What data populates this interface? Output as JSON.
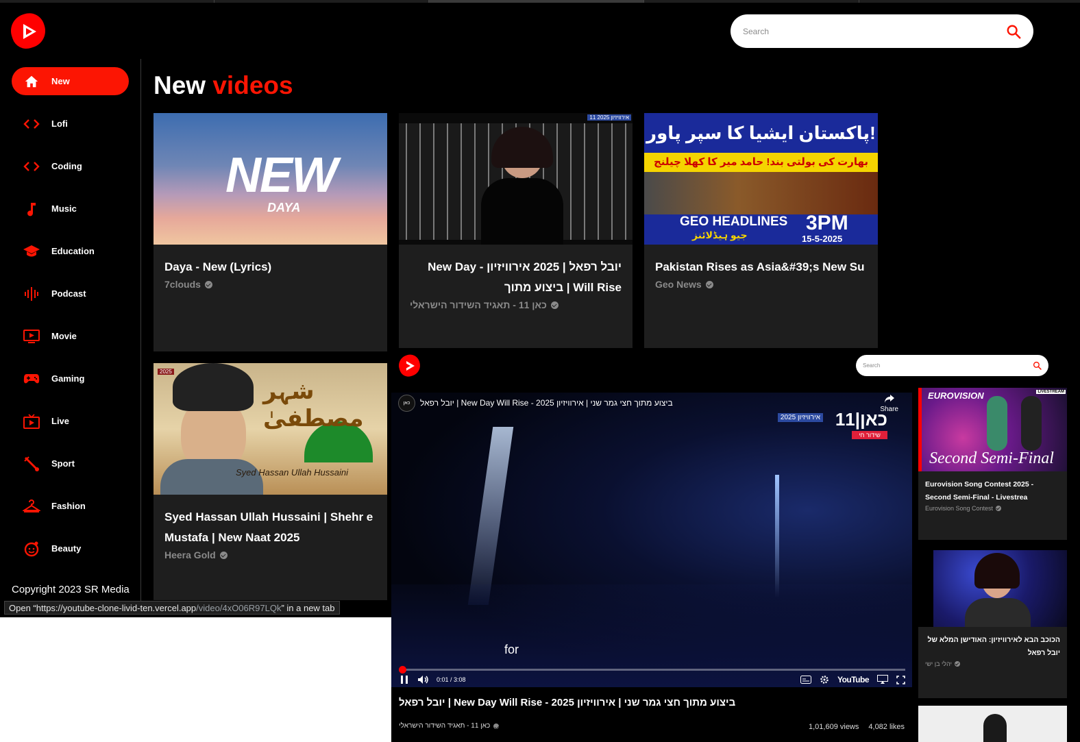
{
  "app": {
    "brand_color": "#fc1503"
  },
  "header": {
    "search_placeholder": "Search",
    "search_icon": "search-icon"
  },
  "sidebar": {
    "items": [
      {
        "label": "New",
        "icon": "home-icon",
        "active": true
      },
      {
        "label": "Lofi",
        "icon": "code-icon",
        "active": false
      },
      {
        "label": "Coding",
        "icon": "code-icon",
        "active": false
      },
      {
        "label": "Music",
        "icon": "music-note-icon",
        "active": false
      },
      {
        "label": "Education",
        "icon": "graduation-cap-icon",
        "active": false
      },
      {
        "label": "Podcast",
        "icon": "podcast-icon",
        "active": false
      },
      {
        "label": "Movie",
        "icon": "movie-icon",
        "active": false
      },
      {
        "label": "Gaming",
        "icon": "gamepad-icon",
        "active": false
      },
      {
        "label": "Live",
        "icon": "live-tv-icon",
        "active": false
      },
      {
        "label": "Sport",
        "icon": "sport-icon",
        "active": false
      },
      {
        "label": "Fashion",
        "icon": "hanger-icon",
        "active": false
      },
      {
        "label": "Beauty",
        "icon": "face-icon",
        "active": false
      }
    ],
    "copyright": "Copyright 2023 SR Media"
  },
  "main": {
    "heading_word1": "New",
    "heading_word2": "videos",
    "videos": [
      {
        "title": "Daya - New (Lyrics)",
        "channel": "7clouds",
        "thumb_text": "NEW",
        "thumb_sub": "DAYA"
      },
      {
        "title": "יובל רפאל | 2025 אירוויזיון - New Day Will Rise | ביצוע מתוך",
        "channel": "כאן 11 - תאגיד השידור הישראלי",
        "thumb_badge": "11 אירוויזיון 2025"
      },
      {
        "title": "Pakistan Rises as Asia&#39;s New Su",
        "channel": "Geo News",
        "thumb_line1": "پاکستان ایشیا کا سپر پاور!",
        "thumb_line2": "بھارت کی بولتی بند! حامد میر کا کھلا چیلنج",
        "thumb_line3": "GEO HEADLINES",
        "thumb_line4": "3PM",
        "thumb_line5": "15-5-2025",
        "thumb_line6": "جیو ہیڈلائنز"
      },
      {
        "title": "Syed Hassan Ullah Hussaini | Shehr e Mustafa | New Naat 2025",
        "channel": "Heera Gold",
        "thumb_script": "شہر مصطفیٰ",
        "thumb_name": "Syed Hassan Ullah Hussaini",
        "thumb_badge": "2025"
      }
    ]
  },
  "status_tooltip": {
    "prefix": "Open “https://youtube-clone-livid-ten.vercel.app",
    "path": "/video/4xO06R97LQk",
    "suffix": "” in a new tab"
  },
  "overlay": {
    "search_placeholder": "Search",
    "player": {
      "title": "ביצוע מתוך חצי גמר שני | אירוויזיון 2025 - New Day Will Rise | יובל רפאל",
      "channel_avatar": "כאן",
      "share_label": "Share",
      "brand": "כאן|11",
      "brand_tag1": "אירוויזיון 2025",
      "brand_tag2": "שידור חי",
      "caption": "for",
      "time": "0:01 / 3:08",
      "progress_fraction": 0.005,
      "youtube_label": "YouTube"
    },
    "video_title": "ביצוע מתוך חצי גמר שני | אירוויזיון 2025 - New Day Will Rise | יובל רפאל",
    "video_channel": "כאן 11 - תאגיד השידור הישראלי",
    "views": "1,01,609 views",
    "likes": "4,082 likes",
    "related": [
      {
        "title": "Eurovision Song Contest 2025 - Second Semi-Final - Livestrea",
        "channel": "Eurovision Song Contest",
        "thumb_text": "Second Semi-Final",
        "thumb_logo": "EUROVISION",
        "thumb_live": "LIVESTREAM"
      },
      {
        "title": "הכוכב הבא לאירוויזיון: האודישן המלא של יובל רפאל",
        "channel": "יהלי בן ישי"
      }
    ]
  }
}
